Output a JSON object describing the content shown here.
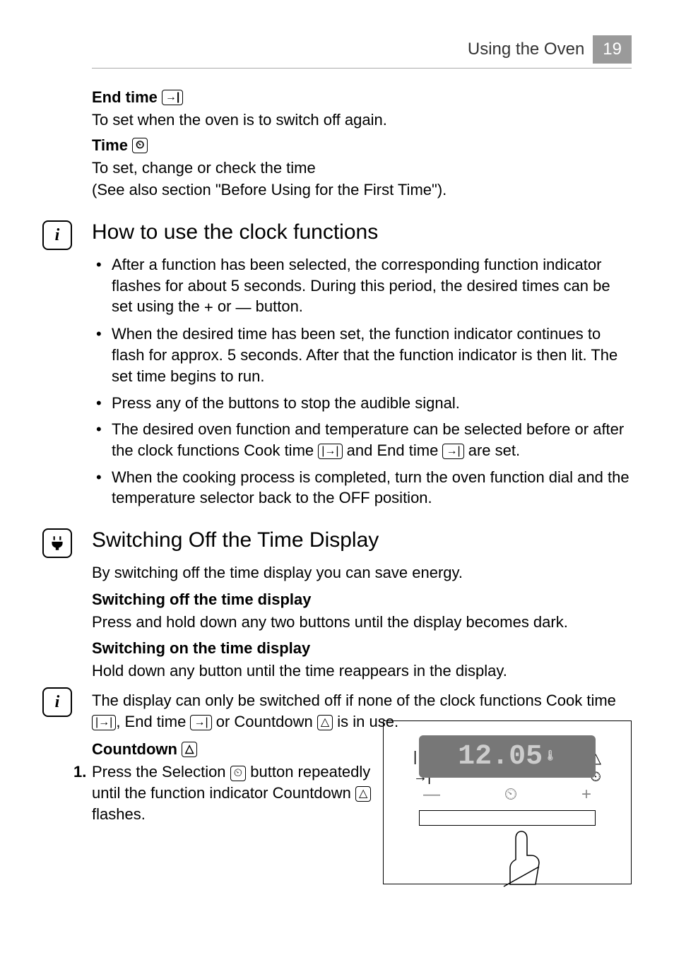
{
  "header": {
    "section": "Using the Oven",
    "page": "19"
  },
  "endtime": {
    "title": "End time",
    "icon": "→|",
    "text": "To set when the oven is to switch off again."
  },
  "time": {
    "title": "Time",
    "icon": "⏲",
    "line1": "To set, change or check the time",
    "line2": "(See also section \"Before Using for the First Time\")."
  },
  "clockfns": {
    "title": "How to use the clock functions",
    "b1a": "After a function has been selected, the corresponding function indicator flashes for about 5 seconds. During this period, the desired times can be set using the ",
    "b1b": " or ",
    "b1c": " button.",
    "b2": "When the desired time has been set, the function indicator continues to flash for approx. 5 seconds. After that the function indicator is then lit. The set time begins to run.",
    "b3": "Press any of the buttons to stop the audible signal.",
    "b4a": "The desired oven function and temperature can be selected before or after the clock functions Cook time ",
    "b4b": " and End time ",
    "b4c": " are set.",
    "b5": "When the cooking process is completed, turn the oven function dial and the temperature selector back to the OFF position."
  },
  "switchoff": {
    "title": "Switching Off the Time Display",
    "intro": "By switching off the time display you can save energy.",
    "off_h": "Switching off the time display",
    "off_t": "Press and hold down any two buttons until the display becomes dark.",
    "on_h": "Switching on the time display",
    "on_t": "Hold down any button until the time reappears in the display.",
    "note_a": "The display can only be switched off if none of the clock functions Cook time ",
    "note_b": ", End time ",
    "note_c": " or Countdown ",
    "note_d": " is in use."
  },
  "countdown": {
    "title": "Countdown",
    "icon": "△",
    "step1a": "Press the Selection ",
    "step1b": " button repeatedly until the function indicator Countdown ",
    "step1c": " flashes."
  },
  "figure": {
    "time": "12.05",
    "minus": "—",
    "select": "⏲",
    "plus": "+",
    "i_cook": "|→|",
    "i_end": "→|",
    "i_alarm": "△",
    "i_clock": "⏲"
  },
  "glyphs": {
    "plus": "+",
    "minus": "—",
    "cooktime": "|→|",
    "endtime": "→|",
    "countdown": "△",
    "select": "⏲"
  }
}
